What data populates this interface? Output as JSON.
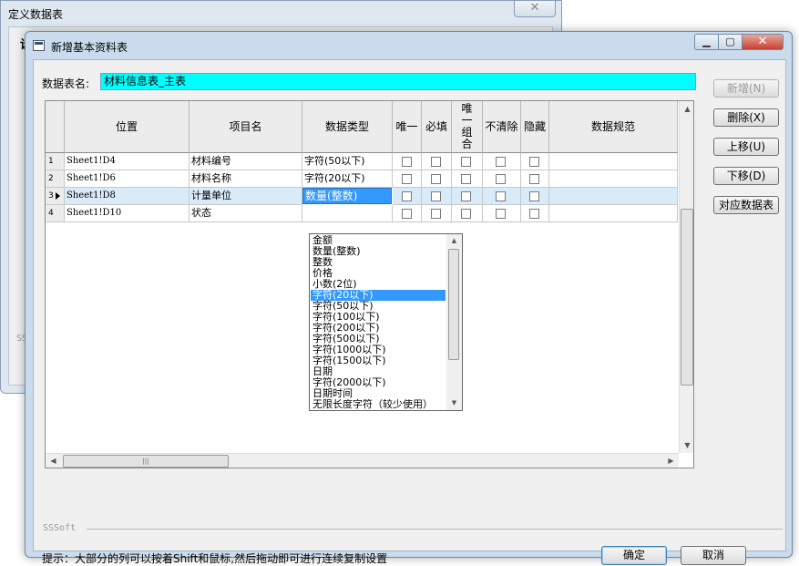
{
  "bg_window": {
    "title": "定义数据表",
    "close_glyph": "✕",
    "fragment": "设",
    "sssoft": "SSS"
  },
  "dialog": {
    "title": "新增基本资料表",
    "table_name_label": "数据表名:",
    "table_name_value": "材料信息表_主表",
    "columns": [
      "位置",
      "项目名",
      "数据类型",
      "唯一",
      "必填",
      "唯一组合",
      "不清除",
      "隐藏",
      "数据规范"
    ],
    "rows": [
      {
        "num": "1",
        "position": "Sheet1!D4",
        "item": "材料编号",
        "type": "字符(50以下)"
      },
      {
        "num": "2",
        "position": "Sheet1!D6",
        "item": "材料名称",
        "type": "字符(20以下)"
      },
      {
        "num": "3",
        "position": "Sheet1!D8",
        "item": "计量单位",
        "type": "数量(整数)"
      },
      {
        "num": "4",
        "position": "Sheet1!D10",
        "item": "状态",
        "type": ""
      }
    ],
    "dropdown_options": [
      "金额",
      "数量(整数)",
      "整数",
      "价格",
      "小数(2位)",
      "字符(20以下)",
      "字符(50以下)",
      "字符(100以下)",
      "字符(200以下)",
      "字符(500以下)",
      "字符(1000以下)",
      "字符(1500以下)",
      "日期",
      "字符(2000以下)",
      "日期时间",
      "无限长度字符（较少使用）"
    ],
    "dropdown_selected": "字符(20以下)",
    "buttons": {
      "add": "新增(N)",
      "delete": "删除(X)",
      "move_up": "上移(U)",
      "move_down": "下移(D)",
      "map_table": "对应数据表",
      "ok": "确定",
      "cancel": "取消"
    },
    "brand": "SSSoft",
    "hint": "提示：大部分的列可以按着Shift和鼠标,然后拖动即可进行连续复制设置"
  }
}
